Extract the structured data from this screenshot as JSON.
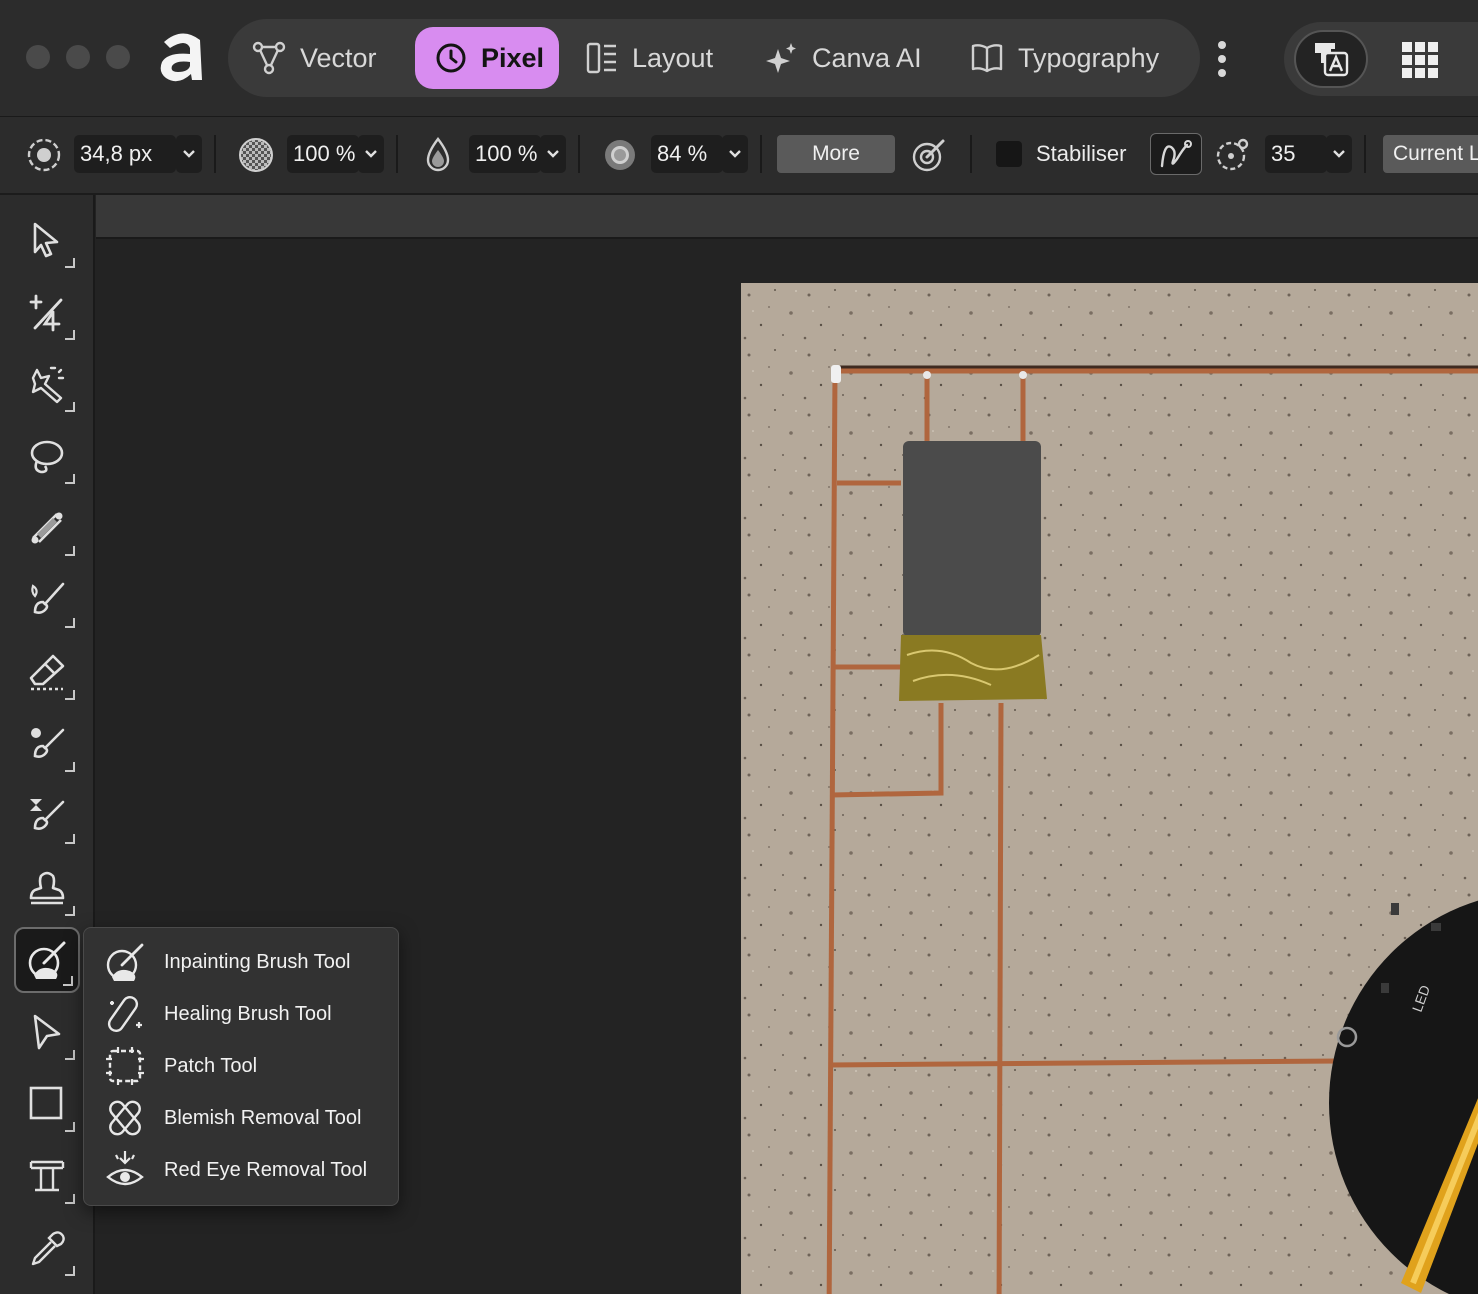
{
  "titlebar": {
    "personas": [
      {
        "label": "Vector",
        "icon": "vector-icon",
        "active": false
      },
      {
        "label": "Pixel",
        "icon": "pixel-icon",
        "active": true
      },
      {
        "label": "Layout",
        "icon": "layout-icon",
        "active": false
      },
      {
        "label": "Canva AI",
        "icon": "sparkle-icon",
        "active": false
      },
      {
        "label": "Typography",
        "icon": "book-icon",
        "active": false
      }
    ],
    "accent_color": "#d88cf0"
  },
  "context": {
    "width_value": "34,8 px",
    "opacity_value": "100 %",
    "flow_value": "100 %",
    "hardness_value": "84 %",
    "more_label": "More",
    "stabiliser_label": "Stabiliser",
    "stabiliser_value": "35",
    "current_label": "Current L"
  },
  "tools": [
    {
      "name": "move-tool",
      "icon": "pointer-icon"
    },
    {
      "name": "crop-tool",
      "icon": "crop-icon"
    },
    {
      "name": "selection-brush-tool",
      "icon": "magic-wand-icon"
    },
    {
      "name": "lasso-tool",
      "icon": "lasso-icon"
    },
    {
      "name": "gradient-tool",
      "icon": "gradient-icon"
    },
    {
      "name": "paint-brush-tool",
      "icon": "brush-icon"
    },
    {
      "name": "erase-tool",
      "icon": "eraser-icon"
    },
    {
      "name": "dodge-tool",
      "icon": "dodge-icon"
    },
    {
      "name": "blur-tool",
      "icon": "blur-icon"
    },
    {
      "name": "clone-tool",
      "icon": "stamp-icon"
    },
    {
      "name": "inpainting-tool",
      "icon": "inpainting-icon",
      "active": true
    },
    {
      "name": "node-tool",
      "icon": "node-pointer-icon"
    },
    {
      "name": "rectangle-tool",
      "icon": "rectangle-icon"
    },
    {
      "name": "text-tool",
      "icon": "text-icon"
    },
    {
      "name": "color-picker-tool",
      "icon": "eyedropper-icon"
    }
  ],
  "flyout": {
    "items": [
      {
        "label": "Inpainting Brush Tool",
        "icon": "inpainting-brush-icon"
      },
      {
        "label": "Healing Brush Tool",
        "icon": "healing-brush-icon"
      },
      {
        "label": "Patch Tool",
        "icon": "patch-icon"
      },
      {
        "label": "Blemish Removal Tool",
        "icon": "blemish-icon"
      },
      {
        "label": "Red Eye Removal Tool",
        "icon": "red-eye-icon"
      }
    ]
  },
  "pcb_label": "LED"
}
